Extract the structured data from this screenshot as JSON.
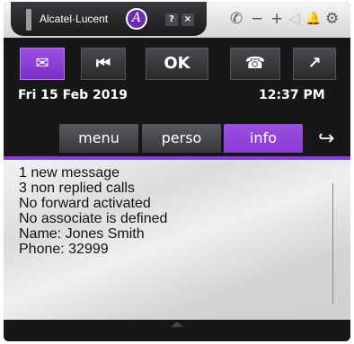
{
  "brand": {
    "name": "Alcatel·Lucent",
    "logo_glyph": "A"
  },
  "window_controls": {
    "help": "?",
    "close": "×"
  },
  "top_icons": [
    "phone-icon",
    "minus-icon",
    "plus-icon",
    "speaker-icon",
    "bell-icon",
    "gear-icon"
  ],
  "top_glyphs": {
    "phone": "✆",
    "minus": "−",
    "plus": "+",
    "speaker": "◁",
    "bell": "🔔",
    "gear": "⚙"
  },
  "buttons": {
    "message": "✉",
    "prev": "⏮",
    "ok": "OK",
    "hangup": "☎",
    "transfer": "↗"
  },
  "status": {
    "date": "Fri 15 Feb 2019",
    "time": "12:37  PM"
  },
  "tabs": [
    {
      "label": "menu",
      "active": false
    },
    {
      "label": "perso",
      "active": false
    },
    {
      "label": "info",
      "active": true
    }
  ],
  "exit_glyph": "↪",
  "info_lines": [
    "1 new message",
    "3 non replied calls",
    "No forward activated",
    "No associate is defined",
    "Name: Jones Smith",
    "Phone: 32999"
  ],
  "colors": {
    "accent": "#8a3cd6",
    "dark": "#17171a"
  }
}
